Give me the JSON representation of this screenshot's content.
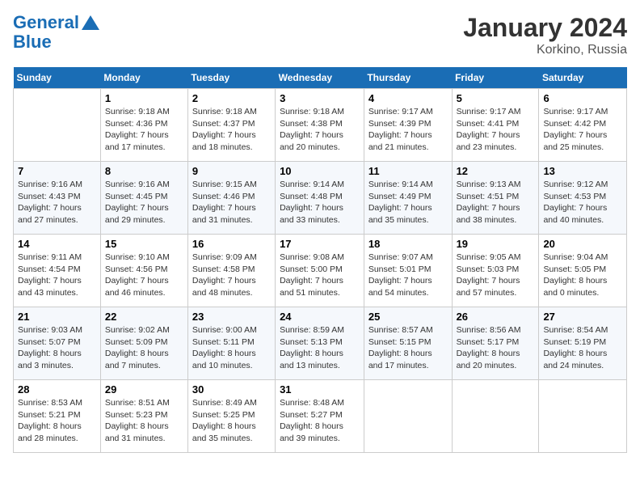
{
  "header": {
    "logo_line1": "General",
    "logo_line2": "Blue",
    "title": "January 2024",
    "subtitle": "Korkino, Russia"
  },
  "days_of_week": [
    "Sunday",
    "Monday",
    "Tuesday",
    "Wednesday",
    "Thursday",
    "Friday",
    "Saturday"
  ],
  "weeks": [
    [
      {
        "day": "",
        "sunrise": "",
        "sunset": "",
        "daylight": ""
      },
      {
        "day": "1",
        "sunrise": "Sunrise: 9:18 AM",
        "sunset": "Sunset: 4:36 PM",
        "daylight": "Daylight: 7 hours and 17 minutes."
      },
      {
        "day": "2",
        "sunrise": "Sunrise: 9:18 AM",
        "sunset": "Sunset: 4:37 PM",
        "daylight": "Daylight: 7 hours and 18 minutes."
      },
      {
        "day": "3",
        "sunrise": "Sunrise: 9:18 AM",
        "sunset": "Sunset: 4:38 PM",
        "daylight": "Daylight: 7 hours and 20 minutes."
      },
      {
        "day": "4",
        "sunrise": "Sunrise: 9:17 AM",
        "sunset": "Sunset: 4:39 PM",
        "daylight": "Daylight: 7 hours and 21 minutes."
      },
      {
        "day": "5",
        "sunrise": "Sunrise: 9:17 AM",
        "sunset": "Sunset: 4:41 PM",
        "daylight": "Daylight: 7 hours and 23 minutes."
      },
      {
        "day": "6",
        "sunrise": "Sunrise: 9:17 AM",
        "sunset": "Sunset: 4:42 PM",
        "daylight": "Daylight: 7 hours and 25 minutes."
      }
    ],
    [
      {
        "day": "7",
        "sunrise": "Sunrise: 9:16 AM",
        "sunset": "Sunset: 4:43 PM",
        "daylight": "Daylight: 7 hours and 27 minutes."
      },
      {
        "day": "8",
        "sunrise": "Sunrise: 9:16 AM",
        "sunset": "Sunset: 4:45 PM",
        "daylight": "Daylight: 7 hours and 29 minutes."
      },
      {
        "day": "9",
        "sunrise": "Sunrise: 9:15 AM",
        "sunset": "Sunset: 4:46 PM",
        "daylight": "Daylight: 7 hours and 31 minutes."
      },
      {
        "day": "10",
        "sunrise": "Sunrise: 9:14 AM",
        "sunset": "Sunset: 4:48 PM",
        "daylight": "Daylight: 7 hours and 33 minutes."
      },
      {
        "day": "11",
        "sunrise": "Sunrise: 9:14 AM",
        "sunset": "Sunset: 4:49 PM",
        "daylight": "Daylight: 7 hours and 35 minutes."
      },
      {
        "day": "12",
        "sunrise": "Sunrise: 9:13 AM",
        "sunset": "Sunset: 4:51 PM",
        "daylight": "Daylight: 7 hours and 38 minutes."
      },
      {
        "day": "13",
        "sunrise": "Sunrise: 9:12 AM",
        "sunset": "Sunset: 4:53 PM",
        "daylight": "Daylight: 7 hours and 40 minutes."
      }
    ],
    [
      {
        "day": "14",
        "sunrise": "Sunrise: 9:11 AM",
        "sunset": "Sunset: 4:54 PM",
        "daylight": "Daylight: 7 hours and 43 minutes."
      },
      {
        "day": "15",
        "sunrise": "Sunrise: 9:10 AM",
        "sunset": "Sunset: 4:56 PM",
        "daylight": "Daylight: 7 hours and 46 minutes."
      },
      {
        "day": "16",
        "sunrise": "Sunrise: 9:09 AM",
        "sunset": "Sunset: 4:58 PM",
        "daylight": "Daylight: 7 hours and 48 minutes."
      },
      {
        "day": "17",
        "sunrise": "Sunrise: 9:08 AM",
        "sunset": "Sunset: 5:00 PM",
        "daylight": "Daylight: 7 hours and 51 minutes."
      },
      {
        "day": "18",
        "sunrise": "Sunrise: 9:07 AM",
        "sunset": "Sunset: 5:01 PM",
        "daylight": "Daylight: 7 hours and 54 minutes."
      },
      {
        "day": "19",
        "sunrise": "Sunrise: 9:05 AM",
        "sunset": "Sunset: 5:03 PM",
        "daylight": "Daylight: 7 hours and 57 minutes."
      },
      {
        "day": "20",
        "sunrise": "Sunrise: 9:04 AM",
        "sunset": "Sunset: 5:05 PM",
        "daylight": "Daylight: 8 hours and 0 minutes."
      }
    ],
    [
      {
        "day": "21",
        "sunrise": "Sunrise: 9:03 AM",
        "sunset": "Sunset: 5:07 PM",
        "daylight": "Daylight: 8 hours and 3 minutes."
      },
      {
        "day": "22",
        "sunrise": "Sunrise: 9:02 AM",
        "sunset": "Sunset: 5:09 PM",
        "daylight": "Daylight: 8 hours and 7 minutes."
      },
      {
        "day": "23",
        "sunrise": "Sunrise: 9:00 AM",
        "sunset": "Sunset: 5:11 PM",
        "daylight": "Daylight: 8 hours and 10 minutes."
      },
      {
        "day": "24",
        "sunrise": "Sunrise: 8:59 AM",
        "sunset": "Sunset: 5:13 PM",
        "daylight": "Daylight: 8 hours and 13 minutes."
      },
      {
        "day": "25",
        "sunrise": "Sunrise: 8:57 AM",
        "sunset": "Sunset: 5:15 PM",
        "daylight": "Daylight: 8 hours and 17 minutes."
      },
      {
        "day": "26",
        "sunrise": "Sunrise: 8:56 AM",
        "sunset": "Sunset: 5:17 PM",
        "daylight": "Daylight: 8 hours and 20 minutes."
      },
      {
        "day": "27",
        "sunrise": "Sunrise: 8:54 AM",
        "sunset": "Sunset: 5:19 PM",
        "daylight": "Daylight: 8 hours and 24 minutes."
      }
    ],
    [
      {
        "day": "28",
        "sunrise": "Sunrise: 8:53 AM",
        "sunset": "Sunset: 5:21 PM",
        "daylight": "Daylight: 8 hours and 28 minutes."
      },
      {
        "day": "29",
        "sunrise": "Sunrise: 8:51 AM",
        "sunset": "Sunset: 5:23 PM",
        "daylight": "Daylight: 8 hours and 31 minutes."
      },
      {
        "day": "30",
        "sunrise": "Sunrise: 8:49 AM",
        "sunset": "Sunset: 5:25 PM",
        "daylight": "Daylight: 8 hours and 35 minutes."
      },
      {
        "day": "31",
        "sunrise": "Sunrise: 8:48 AM",
        "sunset": "Sunset: 5:27 PM",
        "daylight": "Daylight: 8 hours and 39 minutes."
      },
      {
        "day": "",
        "sunrise": "",
        "sunset": "",
        "daylight": ""
      },
      {
        "day": "",
        "sunrise": "",
        "sunset": "",
        "daylight": ""
      },
      {
        "day": "",
        "sunrise": "",
        "sunset": "",
        "daylight": ""
      }
    ]
  ]
}
